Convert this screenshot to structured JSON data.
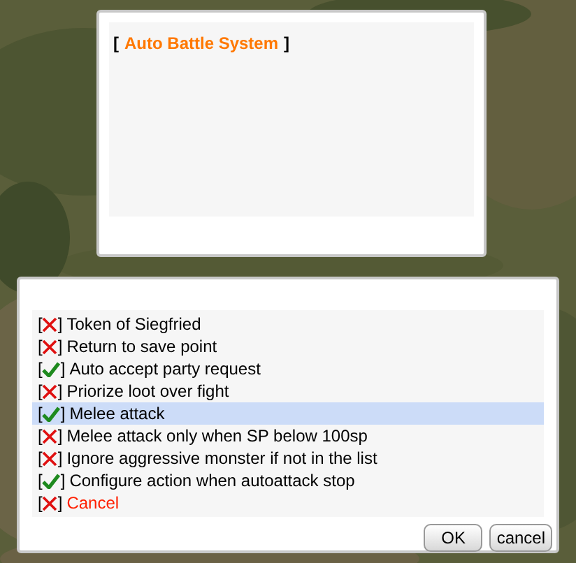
{
  "info_window": {
    "title_open": "[",
    "title": "Auto Battle System",
    "title_close": "]"
  },
  "options_window": {
    "options": [
      {
        "kind": "option",
        "open": "[",
        "checked": false,
        "close": "]",
        "label": "Token of Siegfried",
        "selected": false
      },
      {
        "kind": "option",
        "open": "[",
        "checked": false,
        "close": "]",
        "label": "Return to save point",
        "selected": false
      },
      {
        "kind": "option",
        "open": "[",
        "checked": true,
        "close": "]",
        "label": "Auto accept party request",
        "selected": false
      },
      {
        "kind": "option",
        "open": "[",
        "checked": false,
        "close": "]",
        "label": "Priorize loot over fight",
        "selected": false
      },
      {
        "kind": "option",
        "open": "[",
        "checked": true,
        "close": "]",
        "label": "Melee attack",
        "selected": true
      },
      {
        "kind": "option",
        "open": "[",
        "checked": false,
        "close": "]",
        "label": "Melee attack only when SP below 100sp",
        "selected": false
      },
      {
        "kind": "option",
        "open": "[",
        "checked": false,
        "close": "]",
        "label": "Ignore aggressive monster if not in the list",
        "selected": false
      },
      {
        "kind": "option",
        "open": "[",
        "checked": true,
        "close": "]",
        "label": "Configure action when autoattack stop",
        "selected": false
      },
      {
        "kind": "cancel",
        "open": "[",
        "checked": false,
        "close": "]",
        "label": "Cancel",
        "selected": false
      }
    ],
    "buttons": [
      "OK",
      "cancel"
    ]
  }
}
